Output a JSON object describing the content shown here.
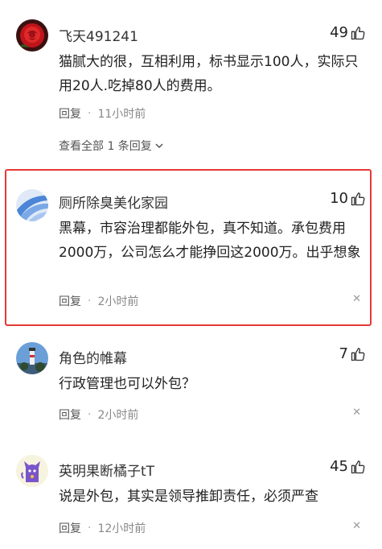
{
  "comments": [
    {
      "username": "飞天491241",
      "likes": "49",
      "text": "猫腻大的很，互相利用，标书显示100人，实际只用20人.吃掉80人的费用。",
      "reply_label": "回复",
      "time": "11小时前",
      "expand_label": "查看全部 1 条回复",
      "avatar_icon": "red-rose-avatar"
    },
    {
      "username": "厕所除臭美化家园",
      "likes": "10",
      "text": "黑幕，市容治理都能外包，真不知道。承包费用2000万，公司怎么才能挣回这2000万。出乎想象",
      "reply_label": "回复",
      "time": "2小时前",
      "avatar_icon": "blue-waves-avatar"
    },
    {
      "username": "角色的帷幕",
      "likes": "7",
      "text": "行政管理也可以外包？",
      "reply_label": "回复",
      "time": "2小时前",
      "avatar_icon": "lighthouse-avatar"
    },
    {
      "username": "英明果断橘子tT",
      "likes": "45",
      "text": "说是外包，其实是领导推卸责任，必须严查",
      "reply_label": "回复",
      "time": "12小时前",
      "avatar_icon": "purple-cat-avatar"
    }
  ],
  "colors": {
    "highlight": "#e53935",
    "meta": "#888888"
  }
}
